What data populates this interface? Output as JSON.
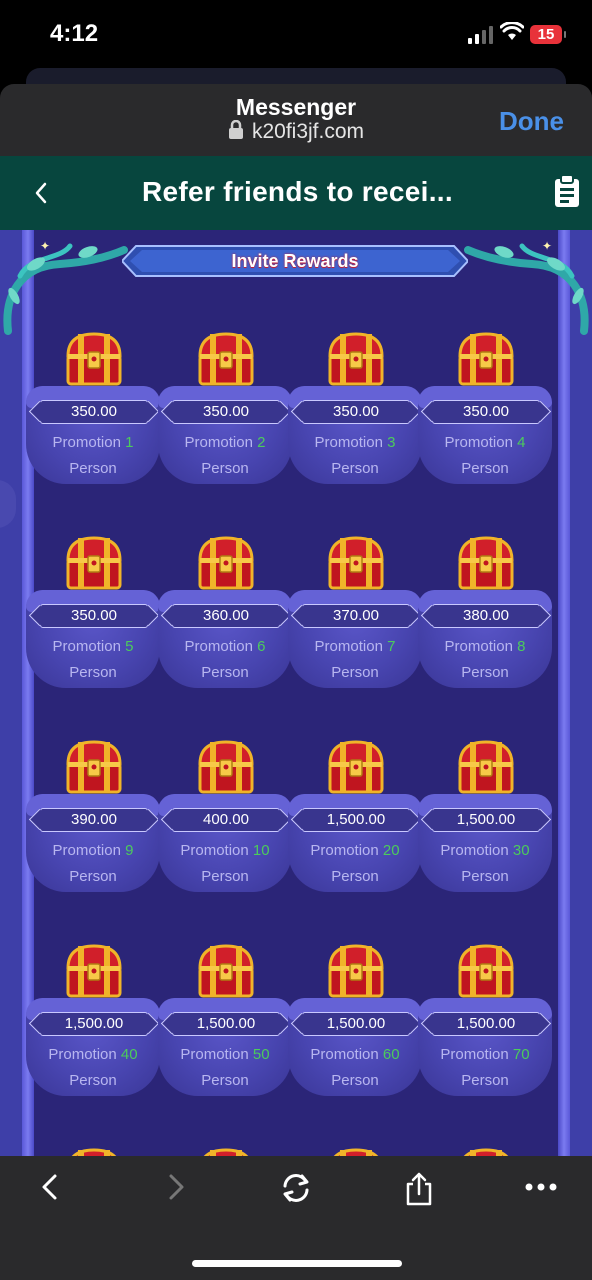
{
  "status": {
    "time": "4:12",
    "battery": "15"
  },
  "browser": {
    "site_name": "Messenger",
    "url": "k20fi3jf.com",
    "done_label": "Done"
  },
  "app": {
    "title": "Refer friends to recei..."
  },
  "rewards": {
    "banner": "Invite Rewards",
    "unit_prefix": "Promotion",
    "unit_suffix": "Person",
    "items": [
      {
        "amount": "350.00",
        "count": "1"
      },
      {
        "amount": "350.00",
        "count": "2"
      },
      {
        "amount": "350.00",
        "count": "3"
      },
      {
        "amount": "350.00",
        "count": "4"
      },
      {
        "amount": "350.00",
        "count": "5"
      },
      {
        "amount": "360.00",
        "count": "6"
      },
      {
        "amount": "370.00",
        "count": "7"
      },
      {
        "amount": "380.00",
        "count": "8"
      },
      {
        "amount": "390.00",
        "count": "9"
      },
      {
        "amount": "400.00",
        "count": "10"
      },
      {
        "amount": "1,500.00",
        "count": "20"
      },
      {
        "amount": "1,500.00",
        "count": "30"
      },
      {
        "amount": "1,500.00",
        "count": "40"
      },
      {
        "amount": "1,500.00",
        "count": "50"
      },
      {
        "amount": "1,500.00",
        "count": "60"
      },
      {
        "amount": "1,500.00",
        "count": "70"
      }
    ]
  },
  "colors": {
    "accent_green": "#4ccb5c",
    "done_blue": "#4a90e8",
    "title_bar": "#07463e",
    "content_bg": "#2b2578"
  },
  "icons": {
    "back": "chevron-left-icon",
    "clipboard": "clipboard-icon",
    "lock": "lock-icon",
    "chest": "treasure-chest-icon"
  }
}
